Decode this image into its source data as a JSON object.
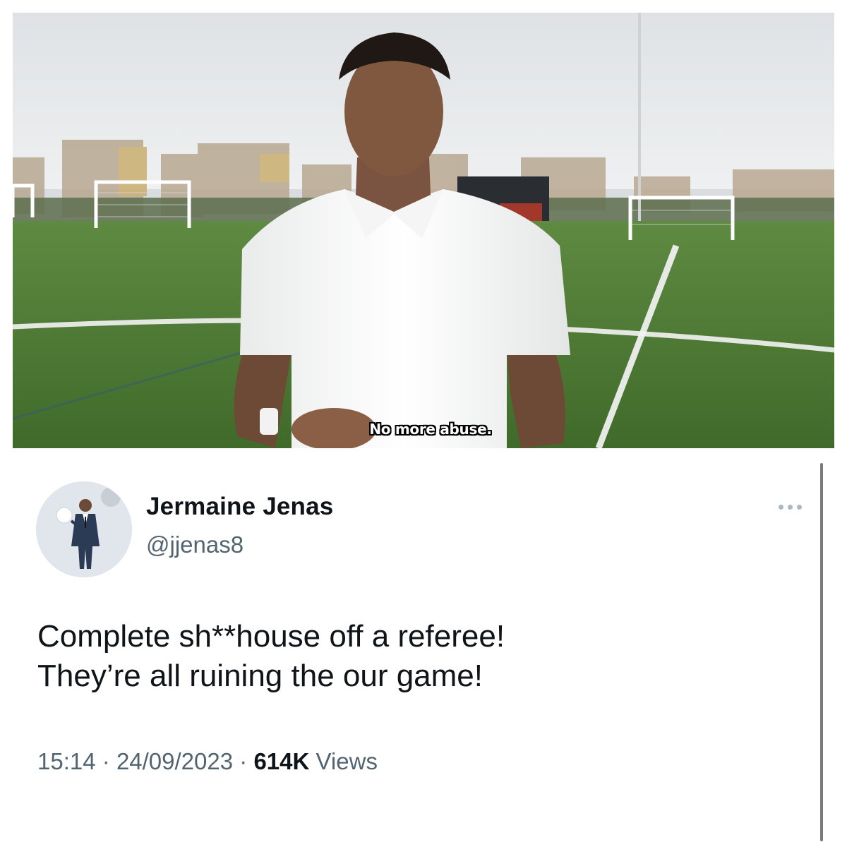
{
  "video": {
    "caption": "No more abuse."
  },
  "tweet": {
    "author": {
      "display_name": "Jermaine Jenas",
      "handle": "@jjenas8"
    },
    "text_lines": [
      "Complete sh**house off a referee!",
      "They’re all ruining the our game!"
    ],
    "time": "15:14",
    "date": "24/09/2023",
    "separator": "·",
    "views_count": "614K",
    "views_label": "Views",
    "more_icon": "more-horizontal-icon"
  },
  "colors": {
    "text_primary": "#0f1419",
    "text_secondary": "#536471",
    "pitch_green": "#4f7a34",
    "sky": "#e6e8ea"
  }
}
